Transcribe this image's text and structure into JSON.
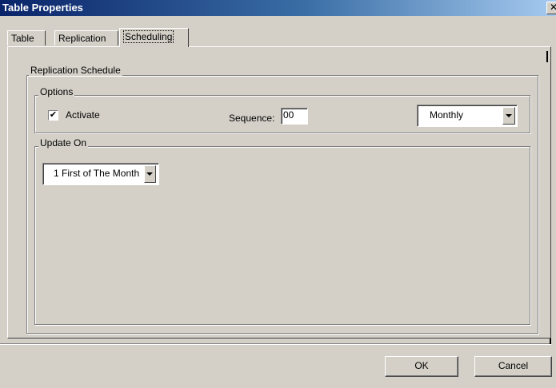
{
  "window": {
    "title": "Table Properties",
    "close_glyph": "✕"
  },
  "tabs": [
    {
      "label": "Table",
      "active": false
    },
    {
      "label": "Replication",
      "active": false
    },
    {
      "label": "Scheduling",
      "active": true
    }
  ],
  "schedule": {
    "group_title": "Replication Schedule",
    "options": {
      "group_title": "Options",
      "activate_label": "Activate",
      "activate_checked": true,
      "check_glyph": "✔",
      "sequence_label": "Sequence:",
      "sequence_value": "00",
      "frequency_value": "Monthly"
    },
    "update_on": {
      "group_title": "Update On",
      "day_value": "1 First of The Month"
    }
  },
  "buttons": {
    "ok_label": "OK",
    "cancel_label": "Cancel"
  },
  "colors": {
    "title_bar_start": "#0a246a",
    "title_bar_end": "#a6caf0",
    "dialog_face": "#d4d0c8"
  }
}
